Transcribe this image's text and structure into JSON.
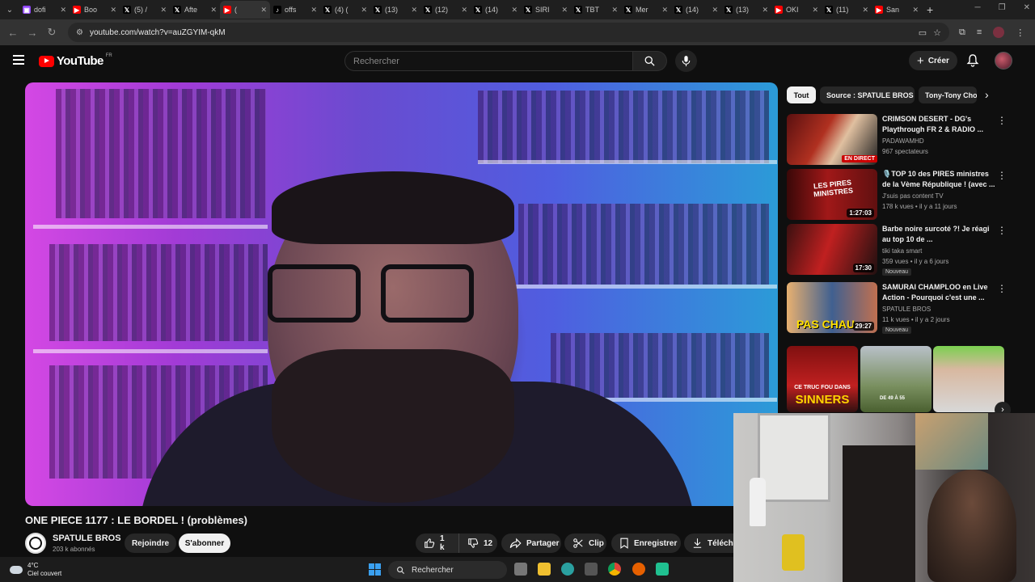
{
  "browser": {
    "tabs": [
      {
        "title": "dofi",
        "favicon": "twitch",
        "color": "#9146ff",
        "active": false
      },
      {
        "title": "Boo",
        "favicon": "youtube",
        "color": "#ff0000",
        "active": false
      },
      {
        "title": "(5) /",
        "favicon": "x",
        "color": "#000000",
        "active": false
      },
      {
        "title": "Afte",
        "favicon": "x",
        "color": "#000000",
        "active": false
      },
      {
        "title": "(",
        "favicon": "youtube",
        "color": "#ff0000",
        "active": true
      },
      {
        "title": "offs",
        "favicon": "tiktok",
        "color": "#000000",
        "active": false
      },
      {
        "title": "(4) (",
        "favicon": "x",
        "color": "#000000",
        "active": false
      },
      {
        "title": "(13)",
        "favicon": "x",
        "color": "#000000",
        "active": false
      },
      {
        "title": "(12)",
        "favicon": "x",
        "color": "#000000",
        "active": false
      },
      {
        "title": "(14)",
        "favicon": "x",
        "color": "#000000",
        "active": false
      },
      {
        "title": "SIRI",
        "favicon": "x",
        "color": "#000000",
        "active": false
      },
      {
        "title": "TBT",
        "favicon": "x",
        "color": "#000000",
        "active": false
      },
      {
        "title": "Mer",
        "favicon": "x",
        "color": "#000000",
        "active": false
      },
      {
        "title": "(14)",
        "favicon": "x",
        "color": "#000000",
        "active": false
      },
      {
        "title": "(13)",
        "favicon": "x",
        "color": "#000000",
        "active": false
      },
      {
        "title": "OKI",
        "favicon": "youtube",
        "color": "#ff0000",
        "active": false
      },
      {
        "title": "(11)",
        "favicon": "x",
        "color": "#000000",
        "active": false
      },
      {
        "title": "San",
        "favicon": "youtube",
        "color": "#ff0000",
        "active": false
      }
    ],
    "url": "youtube.com/watch?v=auZGYIM-qkM"
  },
  "youtube": {
    "logo_text": "YouTube",
    "country_code": "FR",
    "search_placeholder": "Rechercher",
    "create_label": "Créer",
    "accent": "#ff0000"
  },
  "video": {
    "title": "ONE PIECE 1177 : LE BORDEL ! (problèmes)",
    "channel": "SPATULE BROS",
    "subscribers": "203 k abonnés",
    "join_label": "Rejoindre",
    "subscribe_label": "S'abonner",
    "likes": "1 k",
    "dislikes": "12",
    "share_label": "Partager",
    "clip_label": "Clip",
    "save_label": "Enregistrer",
    "download_label": "Télécha"
  },
  "sidebar": {
    "chips": [
      "Tout",
      "Source : SPATULE BROS",
      "Tony-Tony Cho"
    ],
    "recommendations": [
      {
        "title": "CRIMSON DESERT - DG's Playthrough FR 2 & RADIO ...",
        "channel": "PADAWAMHD",
        "stats": "967 spectateurs",
        "badge": "EN DIRECT",
        "new": ""
      },
      {
        "title": "🎙️TOP 10 des PIRES ministres de la Vème République ! (avec ...",
        "channel": "J'suis pas content TV",
        "stats": "178 k vues • il y a 11 jours",
        "badge": "1:27:03",
        "new": ""
      },
      {
        "title": "Barbe noire surcoté ?! Je réagi au top 10 de ...",
        "channel": "tiki taka smart",
        "stats": "359 vues • il y a 6 jours",
        "badge": "17:30",
        "new": "Nouveau"
      },
      {
        "title": "SAMURAI CHAMPLOO en Live Action - Pourquoi c'est une ...",
        "channel": "SPATULE BROS",
        "stats": "11 k vues • il y a 2 jours",
        "badge": "29:27",
        "new": "Nouveau"
      }
    ],
    "thumb_texts": [
      "LES PIRES MINISTRES",
      "PAS CHAU"
    ],
    "shorts_texts": [
      "CE TRUC FOU DANS",
      "SINNERS",
      "DE 49 À 55"
    ]
  },
  "taskbar": {
    "temperature": "4°C",
    "weather": "Ciel couvert",
    "search_label": "Rechercher"
  }
}
